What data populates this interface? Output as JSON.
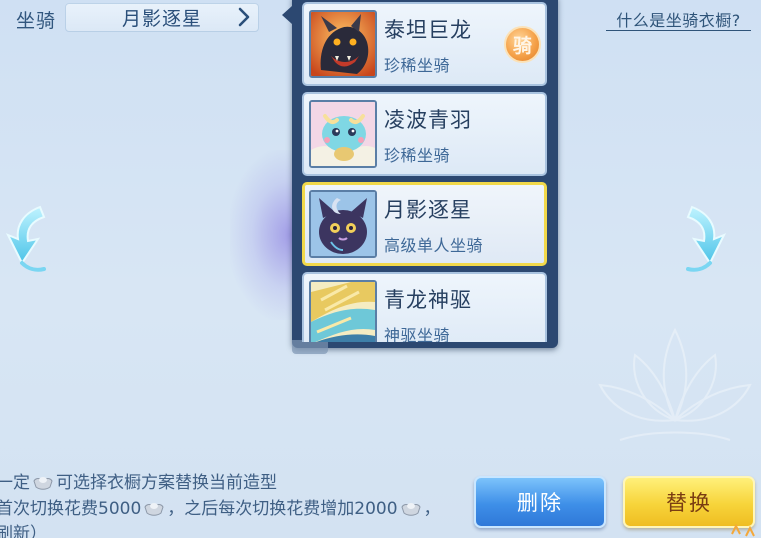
{
  "header": {
    "mount_label": "坐骑",
    "selected_mount": "月影逐星",
    "help_link": "什么是坐骑衣橱?"
  },
  "mount_list": [
    {
      "name": "泰坦巨龙",
      "type": "珍稀坐骑",
      "badge": "骑",
      "selected": false
    },
    {
      "name": "凌波青羽",
      "type": "珍稀坐骑",
      "selected": false
    },
    {
      "name": "月影逐星",
      "type": "高级单人坐骑",
      "selected": true
    },
    {
      "name": "青龙神驱",
      "type": "神驱坐骑",
      "selected": false
    }
  ],
  "info": {
    "line1_a": "一定",
    "line1_b": "可选择衣橱方案替换当前造型",
    "line2_a": "首次切换花费5000",
    "line2_b": "，之后每次切换花费增加2000",
    "line2_c": "，",
    "line3": "刷新）"
  },
  "buttons": {
    "delete": "删除",
    "replace": "替换"
  },
  "icons": {
    "prev": "left-curved-arrow-icon",
    "next": "right-curved-arrow-icon",
    "currency": "silver-ingot-icon",
    "chevron": "chevron-right-icon"
  },
  "colors": {
    "selected_border": "#f1d84a",
    "delete_button": "#3e8fe8",
    "replace_button": "#f7d43a",
    "panel": "#2c4871"
  }
}
